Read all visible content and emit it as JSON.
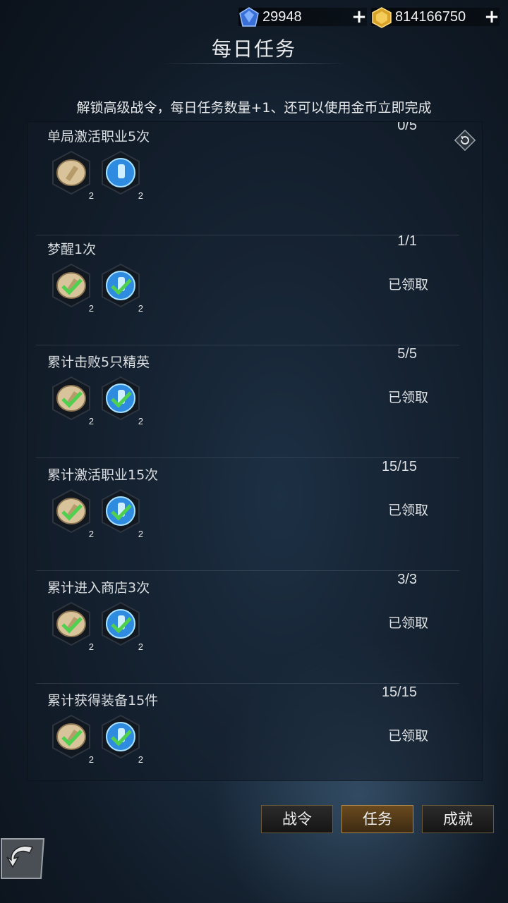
{
  "currencies": [
    {
      "name": "diamond-icon",
      "value": "29948"
    },
    {
      "name": "gold-icon",
      "value": "814166750"
    }
  ],
  "title": "每日任务",
  "notice": "解锁高级战令，每日任务数量+1、还可以使用金币立即完成",
  "tasks": [
    {
      "name": "单局激活职业5次",
      "progress": "0/5",
      "status": "",
      "rewards": [
        {
          "icon": "scroll-icon",
          "count": "2"
        },
        {
          "icon": "potion-icon",
          "count": "2"
        }
      ],
      "claimed": false
    },
    {
      "name": "梦醒1次",
      "progress": "1/1",
      "status": "已领取",
      "rewards": [
        {
          "icon": "scroll-icon",
          "count": "2"
        },
        {
          "icon": "potion-icon",
          "count": "2"
        }
      ],
      "claimed": true
    },
    {
      "name": "累计击败5只精英",
      "progress": "5/5",
      "status": "已领取",
      "rewards": [
        {
          "icon": "scroll-icon",
          "count": "2"
        },
        {
          "icon": "potion-icon",
          "count": "2"
        }
      ],
      "claimed": true
    },
    {
      "name": "累计激活职业15次",
      "progress": "15/15",
      "status": "已领取",
      "rewards": [
        {
          "icon": "scroll-icon",
          "count": "2"
        },
        {
          "icon": "potion-icon",
          "count": "2"
        }
      ],
      "claimed": true
    },
    {
      "name": "累计进入商店3次",
      "progress": "3/3",
      "status": "已领取",
      "rewards": [
        {
          "icon": "scroll-icon",
          "count": "2"
        },
        {
          "icon": "potion-icon",
          "count": "2"
        }
      ],
      "claimed": true
    },
    {
      "name": "累计获得装备15件",
      "progress": "15/15",
      "status": "已领取",
      "rewards": [
        {
          "icon": "scroll-icon",
          "count": "2"
        },
        {
          "icon": "potion-icon",
          "count": "2"
        }
      ],
      "claimed": true
    }
  ],
  "tabs": [
    {
      "label": "战令",
      "active": false
    },
    {
      "label": "任务",
      "active": true
    },
    {
      "label": "成就",
      "active": false
    }
  ],
  "colors": {
    "accent_gold": "#b08a4a",
    "check_green": "#4fd14f"
  }
}
